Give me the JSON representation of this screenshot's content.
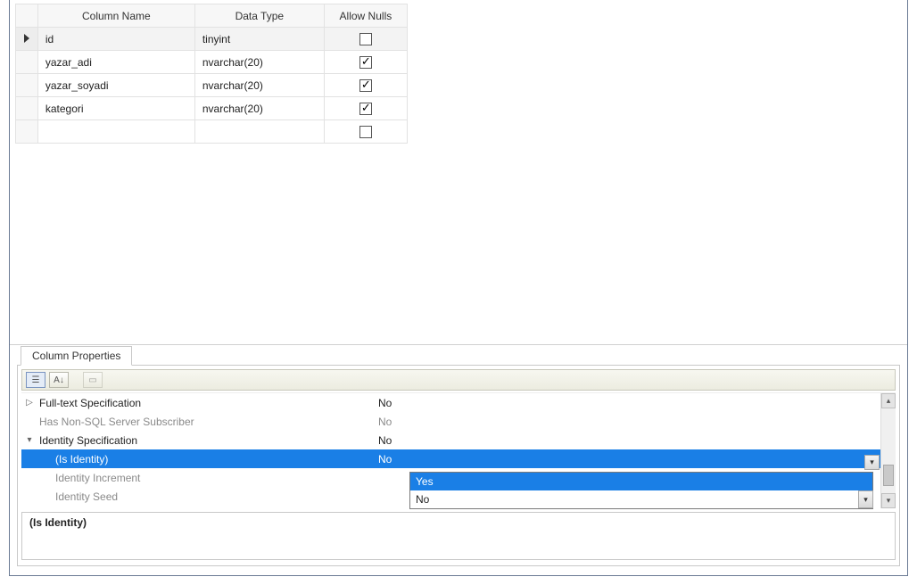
{
  "grid": {
    "headers": {
      "name": "Column Name",
      "type": "Data Type",
      "nulls": "Allow Nulls"
    },
    "rows": [
      {
        "name": "id",
        "type": "tinyint",
        "nulls": false,
        "selected": true
      },
      {
        "name": "yazar_adi",
        "type": "nvarchar(20)",
        "nulls": true
      },
      {
        "name": "yazar_soyadi",
        "type": "nvarchar(20)",
        "nulls": true
      },
      {
        "name": "kategori",
        "type": "nvarchar(20)",
        "nulls": true
      },
      {
        "name": "",
        "type": "",
        "nulls": false,
        "empty": true
      }
    ]
  },
  "props_tab": "Column Properties",
  "properties": {
    "fulltext": {
      "label": "Full-text Specification",
      "value": "No"
    },
    "nonsql": {
      "label": "Has Non-SQL Server Subscriber",
      "value": "No"
    },
    "identity": {
      "label": "Identity Specification",
      "value": "No"
    },
    "isidentity": {
      "label": "(Is Identity)",
      "value": "No"
    },
    "increment": {
      "label": "Identity Increment",
      "value": ""
    },
    "seed": {
      "label": "Identity Seed",
      "value": ""
    }
  },
  "dropdown": {
    "options": [
      "Yes",
      "No"
    ],
    "selected": "Yes"
  },
  "description_title": "(Is Identity)"
}
